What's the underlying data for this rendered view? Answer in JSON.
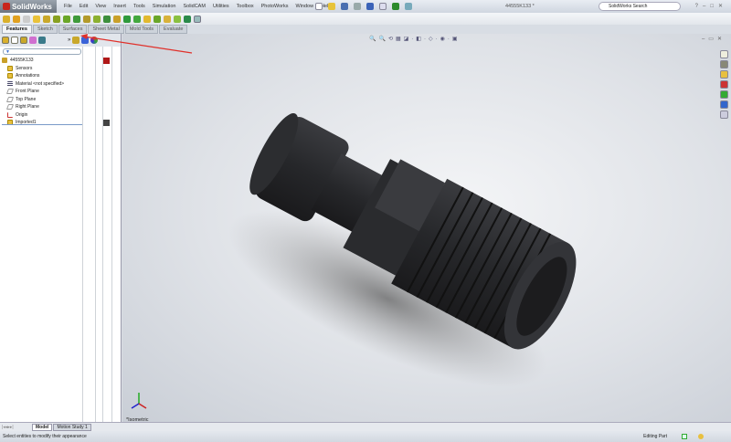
{
  "app": {
    "name": "SolidWorks",
    "document_title": "44555K133 *",
    "search_placeholder": "SolidWorks Search"
  },
  "menu": [
    "File",
    "Edit",
    "View",
    "Insert",
    "Tools",
    "Simulation",
    "SolidCAM",
    "Utilities",
    "Toolbox",
    "PhotoWorks",
    "Window",
    "Help"
  ],
  "command_tabs": [
    "Features",
    "Sketch",
    "Surfaces",
    "Sheet Metal",
    "Mold Tools",
    "Evaluate"
  ],
  "tree": {
    "root": "44555K133",
    "items": [
      {
        "label": "Sensors",
        "icon": "sensor-icon"
      },
      {
        "label": "Annotations",
        "icon": "annotations-icon"
      },
      {
        "label": "Material <not specified>",
        "icon": "material-icon"
      },
      {
        "label": "Front Plane",
        "icon": "plane-icon"
      },
      {
        "label": "Top Plane",
        "icon": "plane-icon"
      },
      {
        "label": "Right Plane",
        "icon": "plane-icon"
      },
      {
        "label": "Origin",
        "icon": "origin-icon"
      },
      {
        "label": "Imported1",
        "icon": "imported-body-icon"
      }
    ]
  },
  "viewport": {
    "view_label": "*Isometric"
  },
  "bottom_tabs": [
    "Model",
    "Motion Study 1"
  ],
  "status": {
    "message": "Select entities to modify their appearance",
    "mode": "Editing Part"
  },
  "colors": {
    "accent_red": "#c8251c",
    "model": "#2a2b2e",
    "annotation_arrow": "#e0302a"
  }
}
